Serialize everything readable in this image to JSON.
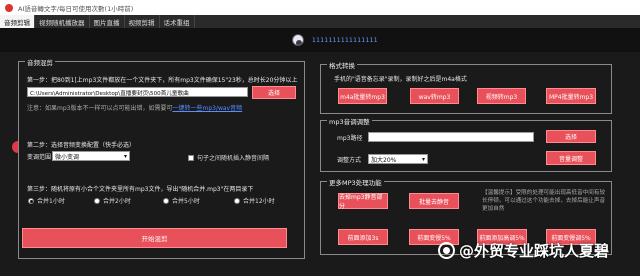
{
  "titlebar": {
    "title": "AI語音轉文字/每日可使用次數(1小時前)"
  },
  "menu": {
    "tabs": [
      {
        "label": "音频剪辑"
      },
      {
        "label": "视频随机播放器"
      },
      {
        "label": "图片直播"
      },
      {
        "label": "视频剪辑"
      },
      {
        "label": "话术重组"
      }
    ]
  },
  "header": {
    "username": "1111111111111111"
  },
  "merge_panel": {
    "title": "音频混剪",
    "step1_text": "第一步：把80到1[上mp3文件都放在一个文件夹下，所有mp3文件确保15\"23秒，总时长20分钟以上",
    "path_value": "C:\\Users\\Administrator\\Desktop\\直播要封页\\500首儿童歌曲",
    "select_button": "选择",
    "note_text": "注意：如果mp3版本不一样可以点可能出错，如需要可",
    "note_link": "一键转一些mp3/wav音频",
    "step2_text": "第二步：选择音频变换配置（快手必选）",
    "variation_label": "变调范围",
    "variation_value": "微小变调",
    "silence_label": "句子之间随机插入静音间隔",
    "step3_text": "第三步：随机将原有小合个文件夹里所有mp3文件，导出\"随机合并.mp3\"在两目录下",
    "radios": [
      {
        "label": "合并1小时",
        "checked": true
      },
      {
        "label": "合并2小时",
        "checked": false
      },
      {
        "label": "合并5小时",
        "checked": false
      },
      {
        "label": "合并12小时",
        "checked": false
      }
    ],
    "start_button": "开始混剪"
  },
  "format_panel": {
    "title": "格式转换",
    "desc": "手机的\"语音备忘录\"录制，录制好之后是m4a格式",
    "buttons": [
      "m4a批量转mp3",
      "wav转mp3",
      "视频转mp3",
      "MP4批量转mp3"
    ]
  },
  "tune_panel": {
    "title": "mp3音调调整",
    "mp3_label": "mp3路径",
    "mp3_value": "",
    "select_button": "选择",
    "mode_label": "调整方式",
    "mode_value": "加大20%",
    "adjust_button": "音量调整"
  },
  "more_panel": {
    "title": "更多MP3处理功能",
    "buttons_top": [
      "去掉mp3静音部分",
      "批量去静音"
    ],
    "info_text": "【温馨提示】受限的处理可能出现高低音中间有较长停顿，可以通过这个功能去掉，去掉后能让声音更加自然",
    "buttons_bottom": [
      "前面添加3s",
      "前面变慢5%",
      "前面添加高调5%",
      "前面变慢调5%"
    ]
  },
  "watermark": {
    "text": "@外贸专业踩坑人夏碧"
  }
}
